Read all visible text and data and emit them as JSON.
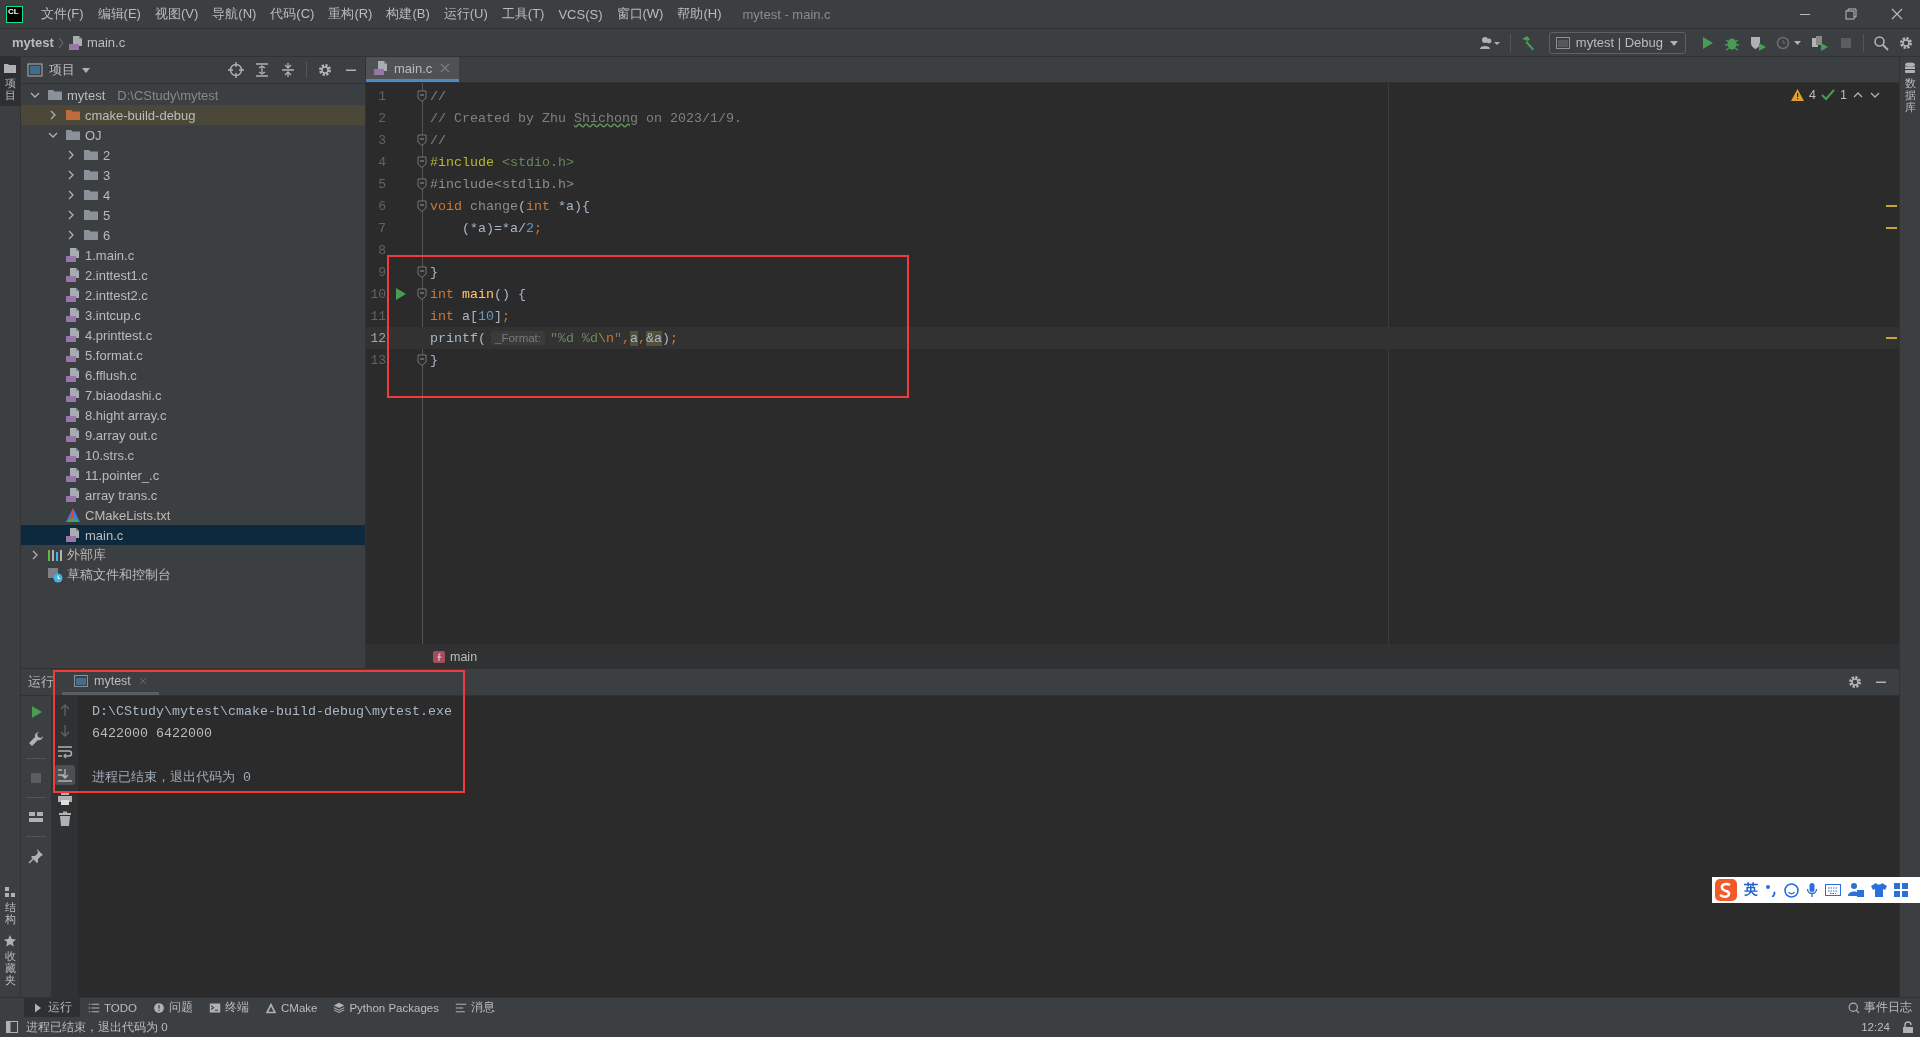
{
  "app": {
    "logo": "CL",
    "menu": [
      "文件(F)",
      "编辑(E)",
      "视图(V)",
      "导航(N)",
      "代码(C)",
      "重构(R)",
      "构建(B)",
      "运行(U)",
      "工具(T)",
      "VCS(S)",
      "窗口(W)",
      "帮助(H)"
    ],
    "title": "mytest - main.c"
  },
  "navbar": {
    "breadcrumb": [
      {
        "kind": "project",
        "label": "mytest"
      },
      {
        "kind": "cfile",
        "label": "main.c"
      }
    ],
    "run_config": "mytest | Debug"
  },
  "left_strip": {
    "top": [
      {
        "label": "项目",
        "selected": true
      }
    ],
    "bottom": [
      {
        "label": "结构",
        "selected": false
      },
      {
        "label": "收藏夹",
        "selected": false
      }
    ]
  },
  "right_strip": [
    {
      "label": "数据库",
      "selected": false
    }
  ],
  "project_panel": {
    "title": "项目",
    "tree": [
      {
        "kind": "folder",
        "label": "mytest",
        "path": "D:\\CStudy\\mytest",
        "expanded": true,
        "selected": false,
        "children": [
          {
            "kind": "build-folder",
            "label": "cmake-build-debug",
            "expanded": false,
            "selected": false
          },
          {
            "kind": "folder",
            "label": "OJ",
            "expanded": true,
            "selected": false,
            "children": [
              {
                "kind": "folder",
                "label": "2",
                "expanded": false,
                "selected": false
              },
              {
                "kind": "folder",
                "label": "3",
                "expanded": false,
                "selected": false
              },
              {
                "kind": "folder",
                "label": "4",
                "expanded": false,
                "selected": false
              },
              {
                "kind": "folder",
                "label": "5",
                "expanded": false,
                "selected": false
              },
              {
                "kind": "folder",
                "label": "6",
                "expanded": false,
                "selected": false
              }
            ]
          },
          {
            "kind": "cfile",
            "label": "1.main.c",
            "selected": false
          },
          {
            "kind": "cfile",
            "label": "2.inttest1.c",
            "selected": false
          },
          {
            "kind": "cfile",
            "label": "2.inttest2.c",
            "selected": false
          },
          {
            "kind": "cfile",
            "label": "3.intcup.c",
            "selected": false
          },
          {
            "kind": "cfile",
            "label": "4.printtest.c",
            "selected": false
          },
          {
            "kind": "cfile",
            "label": "5.format.c",
            "selected": false
          },
          {
            "kind": "cfile",
            "label": "6.fflush.c",
            "selected": false
          },
          {
            "kind": "cfile",
            "label": "7.biaodashi.c",
            "selected": false
          },
          {
            "kind": "cfile",
            "label": "8.hight array.c",
            "selected": false
          },
          {
            "kind": "cfile",
            "label": "9.array out.c",
            "selected": false
          },
          {
            "kind": "cfile",
            "label": "10.strs.c",
            "selected": false
          },
          {
            "kind": "cfile",
            "label": "11.pointer_.c",
            "selected": false
          },
          {
            "kind": "cfile",
            "label": "array trans.c",
            "selected": false
          },
          {
            "kind": "cmake",
            "label": "CMakeLists.txt",
            "selected": false
          },
          {
            "kind": "cfile",
            "label": "main.c",
            "selected": true
          }
        ]
      },
      {
        "kind": "library",
        "label": "外部库",
        "expanded": false,
        "selected": false
      },
      {
        "kind": "scratch",
        "label": "草稿文件和控制台",
        "selected": false
      }
    ]
  },
  "editor": {
    "tabs": [
      {
        "label": "main.c",
        "selected": true
      }
    ],
    "warnings": "4",
    "ok": "1",
    "highlighted_region": true,
    "breadcrumb": "main",
    "lines": [
      {
        "number": "1",
        "fold": true,
        "run": false,
        "current": false,
        "warning": false,
        "tokens": [
          {
            "kind": "comment",
            "text": "//"
          }
        ]
      },
      {
        "number": "2",
        "fold": false,
        "run": false,
        "current": false,
        "warning": false,
        "tokens": [
          {
            "kind": "comment",
            "text": "// Created by Zhu "
          },
          {
            "kind": "typo",
            "text": "Shichong"
          },
          {
            "kind": "comment",
            "text": " on 2023/1/9."
          }
        ]
      },
      {
        "number": "3",
        "fold": true,
        "run": false,
        "current": false,
        "warning": false,
        "tokens": [
          {
            "kind": "comment",
            "text": "//"
          }
        ]
      },
      {
        "number": "4",
        "fold": true,
        "run": false,
        "current": false,
        "warning": false,
        "tokens": [
          {
            "kind": "preproc",
            "text": "#include"
          },
          {
            "kind": "header",
            "text": " <stdio.h>"
          }
        ]
      },
      {
        "number": "5",
        "fold": true,
        "run": false,
        "current": false,
        "warning": false,
        "tokens": [
          {
            "kind": "unused",
            "text": "#include<stdlib.h>"
          }
        ]
      },
      {
        "number": "6",
        "fold": true,
        "run": false,
        "current": false,
        "warning": true,
        "tokens": [
          {
            "kind": "keyword",
            "text": "void"
          },
          {
            "kind": "unused",
            "text": " change"
          },
          {
            "kind": "plain",
            "text": "("
          },
          {
            "kind": "keyword",
            "text": "int"
          },
          {
            "kind": "plain",
            "text": " *a){"
          }
        ]
      },
      {
        "number": "7",
        "fold": false,
        "run": false,
        "current": false,
        "warning": true,
        "tokens": [
          {
            "kind": "plain",
            "text": "    (*a)=*a/"
          },
          {
            "kind": "number",
            "text": "2"
          },
          {
            "kind": "keyword",
            "text": ";"
          }
        ]
      },
      {
        "number": "8",
        "fold": false,
        "run": false,
        "current": false,
        "warning": false
      },
      {
        "number": "9",
        "fold": true,
        "run": false,
        "current": false,
        "warning": false,
        "tokens": [
          {
            "kind": "plain",
            "text": "}"
          }
        ]
      },
      {
        "number": "10",
        "fold": true,
        "run": true,
        "current": false,
        "warning": false,
        "tokens": [
          {
            "kind": "keyword",
            "text": "int"
          },
          {
            "kind": "function",
            "text": " main"
          },
          {
            "kind": "plain",
            "text": "() {"
          }
        ]
      },
      {
        "number": "11",
        "fold": false,
        "run": false,
        "current": false,
        "warning": false,
        "tokens": [
          {
            "kind": "keyword",
            "text": "int"
          },
          {
            "kind": "plain",
            "text": " a["
          },
          {
            "kind": "number",
            "text": "10"
          },
          {
            "kind": "plain",
            "text": "]"
          },
          {
            "kind": "keyword",
            "text": ";"
          }
        ]
      },
      {
        "number": "12",
        "fold": false,
        "run": false,
        "current": true,
        "warning": true,
        "tokens": [
          {
            "kind": "plain",
            "text": "printf("
          },
          {
            "kind": "hint",
            "text": "_Format:"
          },
          {
            "kind": "string",
            "text": "\"%d %d"
          },
          {
            "kind": "escape",
            "text": "\\n"
          },
          {
            "kind": "string",
            "text": "\""
          },
          {
            "kind": "keyword",
            "text": ","
          },
          {
            "kind": "usage",
            "text": "a"
          },
          {
            "kind": "keyword",
            "text": ","
          },
          {
            "kind": "usage",
            "text": "&a"
          },
          {
            "kind": "plain",
            "text": ")"
          },
          {
            "kind": "keyword",
            "text": ";"
          }
        ]
      },
      {
        "number": "13",
        "fold": true,
        "run": false,
        "current": false,
        "warning": false,
        "tokens": [
          {
            "kind": "plain",
            "text": "}"
          }
        ]
      }
    ]
  },
  "run_panel": {
    "title": "运行",
    "tabs": [
      {
        "label": "mytest",
        "selected": true
      }
    ],
    "autoscroll": true,
    "highlighted_region": true,
    "output": [
      {
        "kind": "command",
        "text": "D:\\CStudy\\mytest\\cmake-build-debug\\mytest.exe"
      },
      {
        "kind": "stdout",
        "text": "6422000 6422000"
      },
      {
        "kind": "blank"
      },
      {
        "kind": "exit",
        "text": "进程已结束，退出代码为 0"
      }
    ]
  },
  "tool_windows": {
    "left": [
      {
        "kind": "run",
        "label": "运行",
        "selected": true
      },
      {
        "kind": "todo",
        "label": "TODO",
        "selected": false
      },
      {
        "kind": "problems",
        "label": "问题",
        "selected": false
      },
      {
        "kind": "terminal",
        "label": "终端",
        "selected": false
      },
      {
        "kind": "cmake",
        "label": "CMake",
        "selected": false
      },
      {
        "kind": "python",
        "label": "Python Packages",
        "selected": false
      },
      {
        "kind": "messages",
        "label": "消息",
        "selected": false
      }
    ],
    "right": [
      {
        "kind": "events",
        "label": "事件日志",
        "selected": false
      }
    ]
  },
  "status_bar": {
    "message": "进程已结束，退出代码为 0",
    "time": "12:24"
  },
  "ime_toolbar": {
    "mode": "英"
  }
}
